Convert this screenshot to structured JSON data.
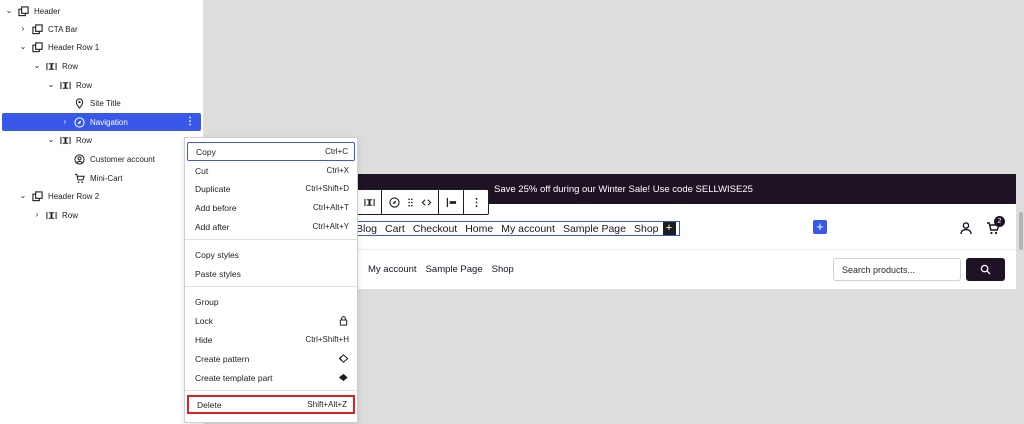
{
  "list_view": {
    "items": [
      {
        "label": "Header",
        "icon": "template-part-icon",
        "expander": "expanded"
      },
      {
        "label": "CTA Bar",
        "icon": "template-part-icon",
        "expander": "collapsed"
      },
      {
        "label": "Header Row 1",
        "icon": "template-part-icon",
        "expander": "expanded"
      },
      {
        "label": "Row",
        "icon": "row-block-icon",
        "expander": "expanded"
      },
      {
        "label": "Row",
        "icon": "row-block-icon",
        "expander": "expanded"
      },
      {
        "label": "Site Title",
        "icon": "map-marker-icon",
        "expander": "none"
      },
      {
        "label": "Navigation",
        "icon": "compass-icon",
        "expander": "collapsed",
        "selected": true
      },
      {
        "label": "Row",
        "icon": "row-block-icon",
        "expander": "expanded"
      },
      {
        "label": "Customer account",
        "icon": "customer-account-icon",
        "expander": "none"
      },
      {
        "label": "Mini-Cart",
        "icon": "mini-cart-icon",
        "expander": "none"
      },
      {
        "label": "Header Row 2",
        "icon": "template-part-icon",
        "expander": "expanded"
      },
      {
        "label": "Row",
        "icon": "row-block-icon",
        "expander": "collapsed"
      }
    ],
    "options_glyph": "⋮"
  },
  "context_menu": {
    "group1": [
      {
        "label": "Copy",
        "shortcut": "Ctrl+C",
        "focused": true
      },
      {
        "label": "Cut",
        "shortcut": "Ctrl+X"
      },
      {
        "label": "Duplicate",
        "shortcut": "Ctrl+Shift+D"
      },
      {
        "label": "Add before",
        "shortcut": "Ctrl+Alt+T"
      },
      {
        "label": "Add after",
        "shortcut": "Ctrl+Alt+Y"
      }
    ],
    "group2": [
      {
        "label": "Copy styles"
      },
      {
        "label": "Paste styles"
      }
    ],
    "group3": [
      {
        "label": "Group",
        "shortcut": ""
      },
      {
        "label": "Lock",
        "shortcut": "",
        "icon": "lock-icon"
      },
      {
        "label": "Hide",
        "shortcut": "Ctrl+Shift+H"
      },
      {
        "label": "Create pattern",
        "shortcut": "",
        "icon": "symbol-icon"
      },
      {
        "label": "Create template part",
        "shortcut": "",
        "icon": "symbol-filled-icon"
      }
    ],
    "group4": [
      {
        "label": "Delete",
        "shortcut": "Shift+Alt+Z",
        "highlighted": true
      }
    ]
  },
  "preview": {
    "cta_text": "Save 25% off during our Winter Sale! Use code SELLWISE25",
    "nav_links": [
      "Blog",
      "Cart",
      "Checkout",
      "Home",
      "My account",
      "Sample Page",
      "Shop"
    ],
    "nav_add": "+",
    "inserter": "+",
    "cart_count": "2",
    "row2_links": [
      "My account",
      "Sample Page",
      "Shop"
    ],
    "search_placeholder": "Search products..."
  },
  "toolbar": {
    "buttons": [
      "row-block-icon",
      "compass-icon",
      "drag-handle-icon",
      "move-arrows-icon",
      "justify-left-icon",
      "more-options-icon"
    ]
  },
  "colors": {
    "accent": "#3858e9",
    "dark": "#1e1224",
    "danger": "#e02020"
  }
}
